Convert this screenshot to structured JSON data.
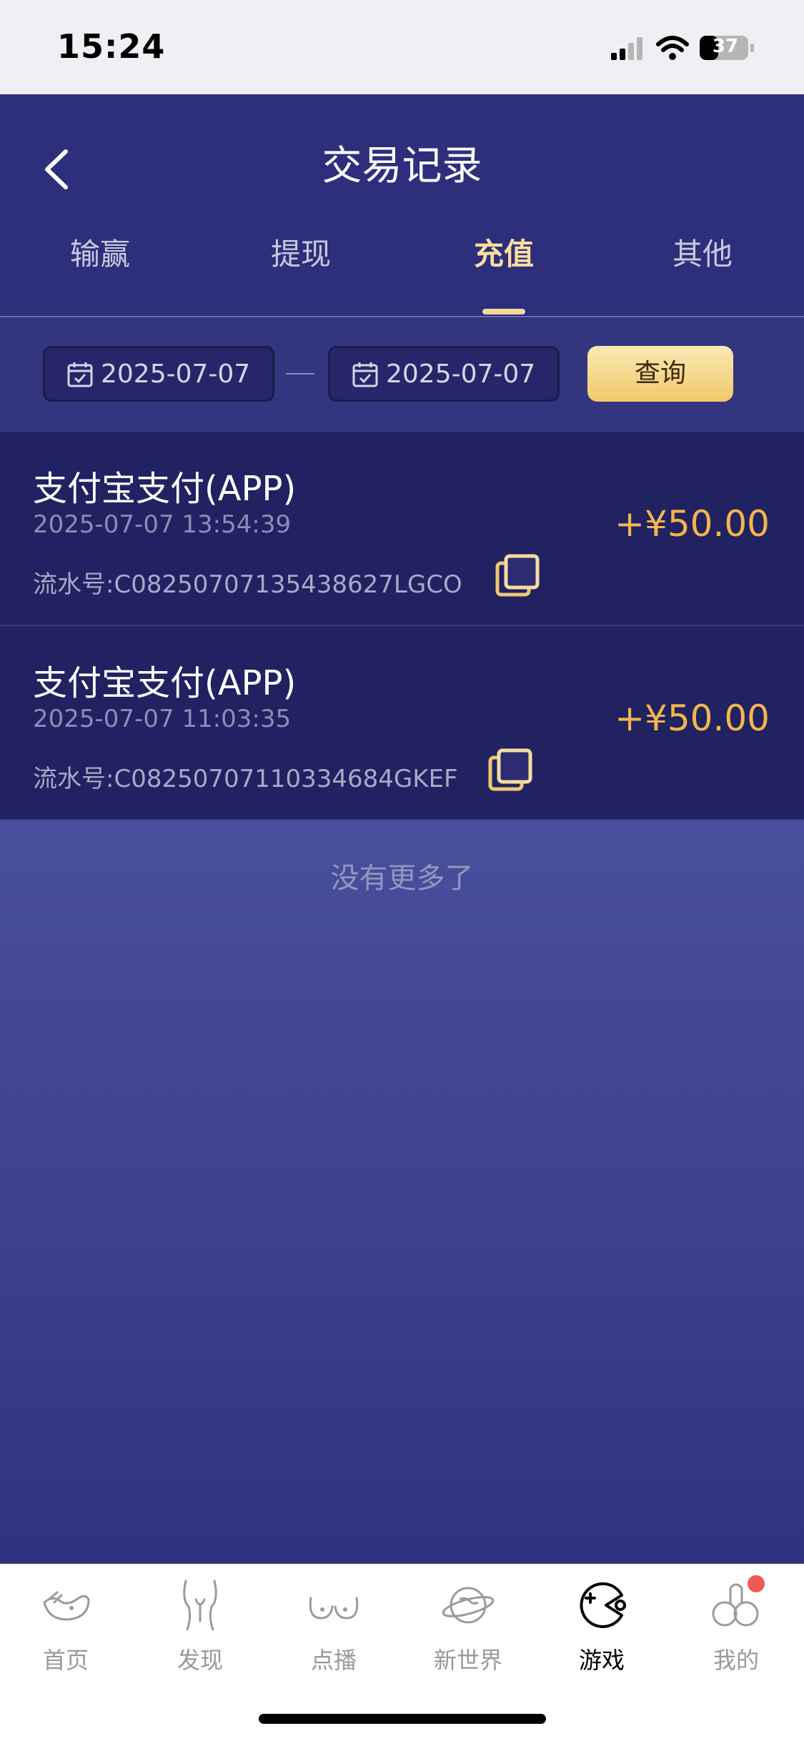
{
  "status_bar": {
    "time": "15:24",
    "battery": "37"
  },
  "header": {
    "title": "交易记录"
  },
  "tabs": [
    {
      "label": "输赢",
      "active": false
    },
    {
      "label": "提现",
      "active": false
    },
    {
      "label": "充值",
      "active": true
    },
    {
      "label": "其他",
      "active": false
    }
  ],
  "filter": {
    "start_date": "2025-07-07",
    "end_date": "2025-07-07",
    "query_label": "查询"
  },
  "records": [
    {
      "title": "支付宝支付(APP)",
      "time": "2025-07-07 13:54:39",
      "serial": "流水号:C08250707135438627LGCO",
      "amount": "+¥50.00"
    },
    {
      "title": "支付宝支付(APP)",
      "time": "2025-07-07 11:03:35",
      "serial": "流水号:C08250707110334684GKEF",
      "amount": "+¥50.00"
    }
  ],
  "list_end_text": "没有更多了",
  "tabbar": [
    {
      "label": "首页",
      "icon": "home-icon",
      "active": false
    },
    {
      "label": "发现",
      "icon": "discover-icon",
      "active": false
    },
    {
      "label": "点播",
      "icon": "vod-icon",
      "active": false
    },
    {
      "label": "新世界",
      "icon": "planet-icon",
      "active": false
    },
    {
      "label": "游戏",
      "icon": "game-icon",
      "active": true
    },
    {
      "label": "我的",
      "icon": "profile-icon",
      "active": false,
      "badge": true
    }
  ],
  "colors": {
    "header_bg": "#2d2e7c",
    "active_tab": "#f7dea0",
    "amount": "#f4b54a",
    "query_button": "#f1c86a",
    "badge": "#ee5b57"
  }
}
